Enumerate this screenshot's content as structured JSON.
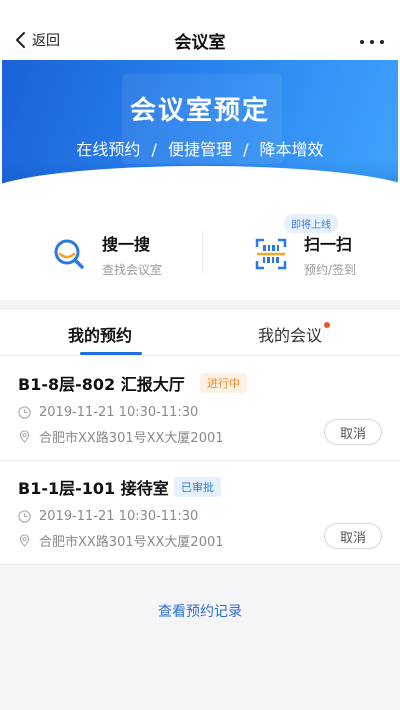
{
  "nav": {
    "back_label": "返回",
    "title": "会议室"
  },
  "banner": {
    "title": "会议室预定",
    "subtitle": "在线预约 / 便捷管理 / 降本增效",
    "dots": 3,
    "active_dot": 0
  },
  "actions": {
    "search": {
      "label": "搜一搜",
      "sub": "查找会议室"
    },
    "scan": {
      "label": "扫一扫",
      "sub": "预约/签到",
      "badge": "即将上线"
    }
  },
  "tabs": [
    {
      "label": "我的预约",
      "active": true
    },
    {
      "label": "我的会议",
      "has_notification": true
    }
  ],
  "bookings": [
    {
      "room": "B1-8层-802 汇报大厅",
      "status": "进行中",
      "time": "2019-11-21 10:30-11:30",
      "address": "合肥市XX路301号XX大厦2001",
      "action": "取消"
    },
    {
      "room": "B1-1层-101 接待室",
      "status": "已审批",
      "time": "2019-11-21 10:30-11:30",
      "address": "合肥市XX路301号XX大厦2001",
      "action": "取消"
    }
  ],
  "footer": {
    "records_link": "查看预约记录"
  },
  "colors": {
    "accent": "#1e6fe6",
    "banner_start": "#1a62d8",
    "banner_end": "#3fa5fb",
    "status_ongoing": "#f08a2a",
    "status_approved": "#2a7ae2",
    "notification": "#f0532c"
  }
}
